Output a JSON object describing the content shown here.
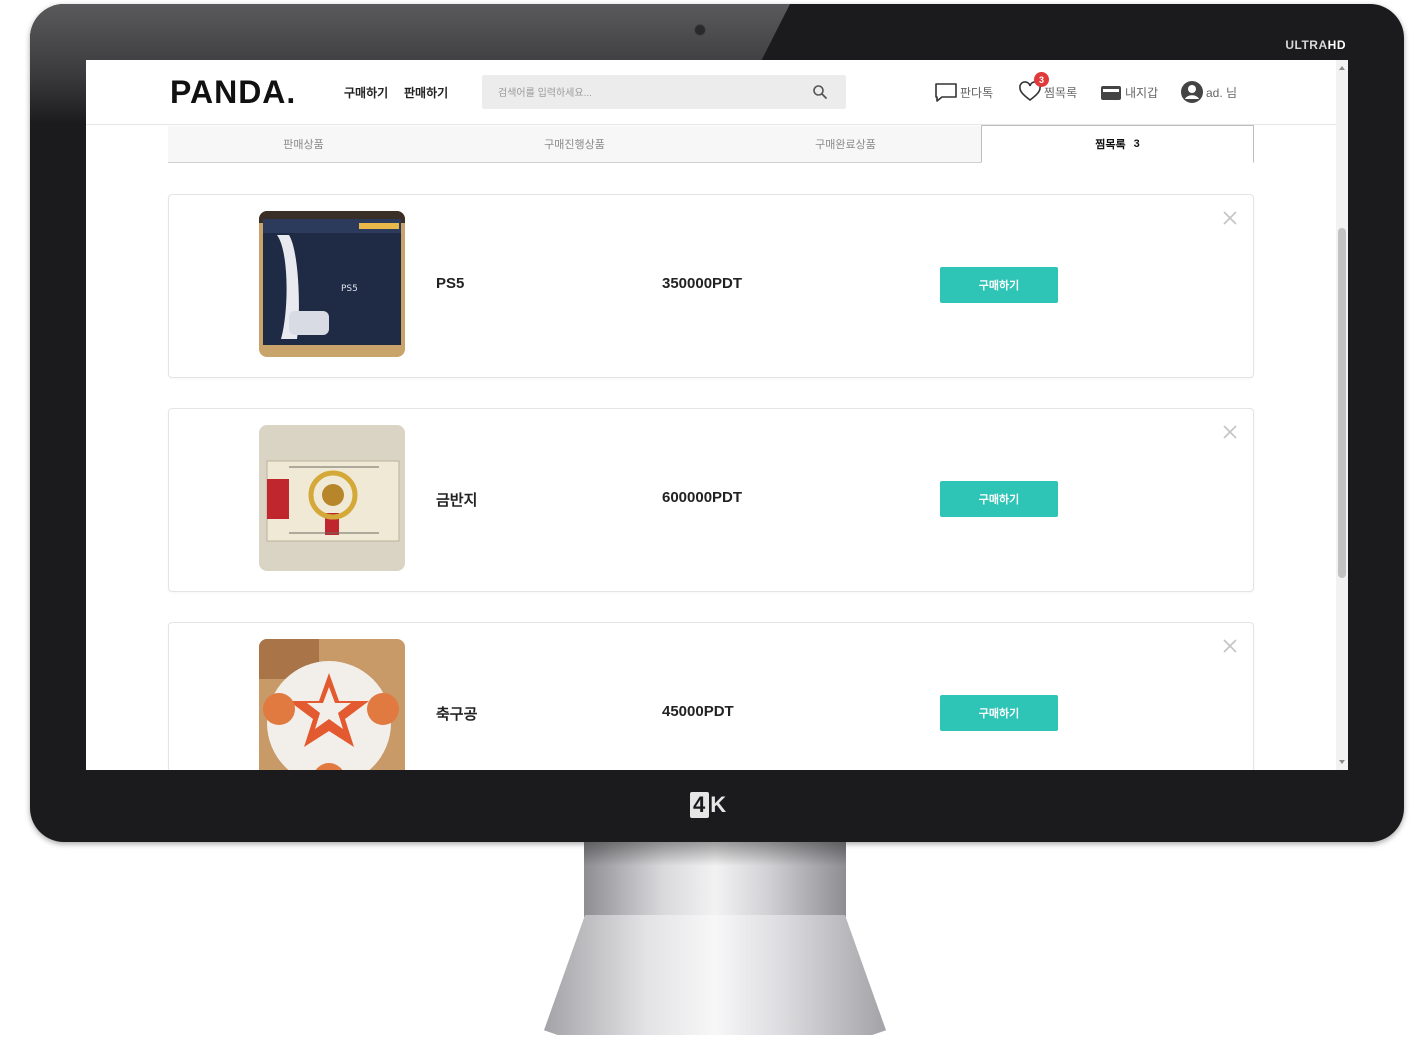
{
  "monitor": {
    "badge_ultra": "ULTRA",
    "badge_hd": "HD",
    "brand_4": "4",
    "brand_k": "K"
  },
  "header": {
    "logo": "PANDA.",
    "nav": {
      "buy": "구매하기",
      "sell": "판매하기"
    },
    "search": {
      "placeholder": "검색어를 입력하세요..."
    },
    "items": {
      "pandatalk": "판다톡",
      "wishlist": "찜목록",
      "wishlist_badge": "3",
      "wallet": "내지갑",
      "user": "ad. 님"
    }
  },
  "tabs": [
    {
      "label": "판매상품",
      "count": ""
    },
    {
      "label": "구매진행상품",
      "count": ""
    },
    {
      "label": "구매완료상품",
      "count": ""
    },
    {
      "label": "찜목록",
      "count": "3"
    }
  ],
  "products": [
    {
      "name": "PS5",
      "price": "350000PDT",
      "button": "구매하기"
    },
    {
      "name": "금반지",
      "price": "600000PDT",
      "button": "구매하기"
    },
    {
      "name": "축구공",
      "price": "45000PDT",
      "button": "구매하기"
    }
  ],
  "colors": {
    "accent": "#2ec4b6",
    "badge": "#e03a3a",
    "bezel": "#1b1b1d"
  },
  "icons": {
    "search": "search-icon",
    "chat": "chat-icon",
    "heart": "heart-icon",
    "wallet": "wallet-icon",
    "user": "user-icon",
    "close": "close-icon"
  }
}
